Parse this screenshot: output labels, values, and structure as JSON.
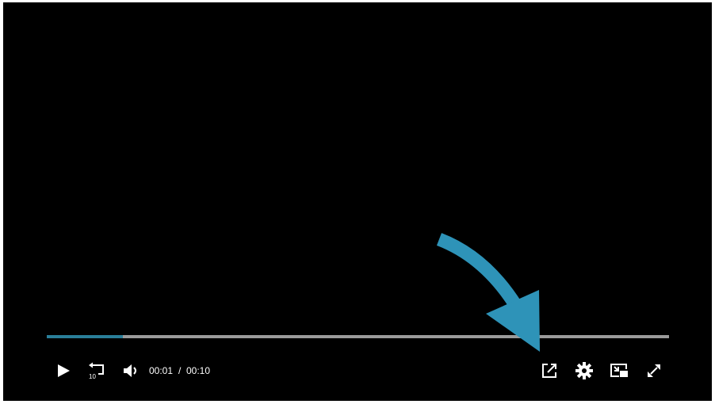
{
  "player": {
    "progress_fraction": 0.122,
    "accent_color": "#2a7f99",
    "track_color": "#9a9a9a",
    "annotation_color": "#2e93b8"
  },
  "controls": {
    "current_time": "00:01",
    "separator": "/",
    "duration": "00:10",
    "rewind_amount": "10",
    "icons": {
      "play": "play-icon",
      "rewind": "rewind-10-icon",
      "volume": "volume-icon",
      "popout": "open-external-icon",
      "settings": "gear-icon",
      "pip": "picture-in-picture-icon",
      "fullscreen": "fullscreen-icon"
    }
  }
}
